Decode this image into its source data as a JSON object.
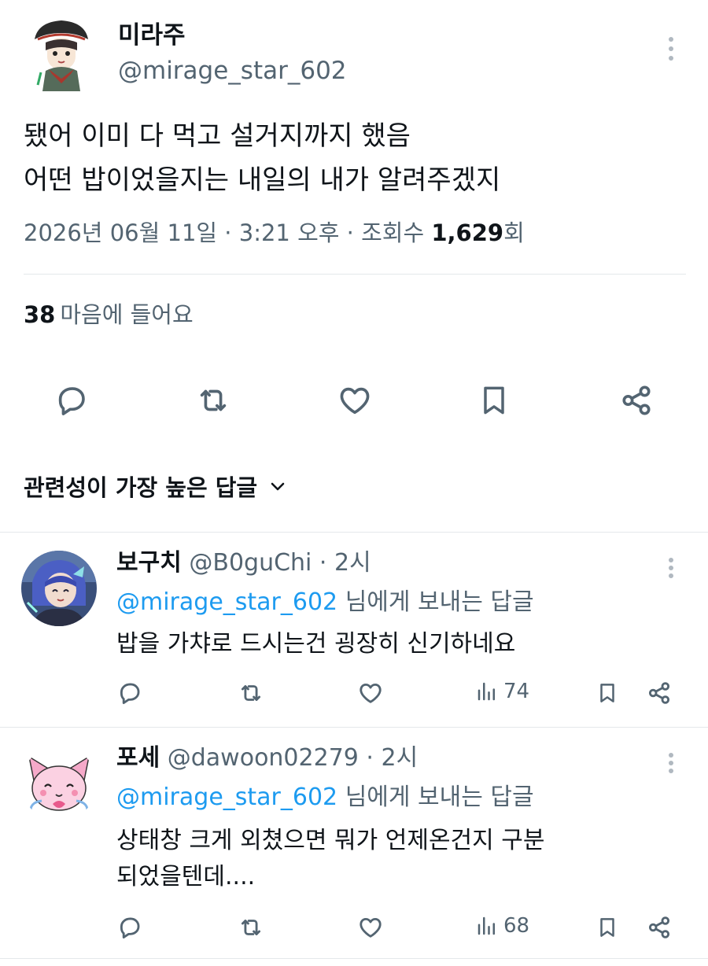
{
  "tweet": {
    "display_name": "미라주",
    "handle": "@mirage_star_602",
    "lines": [
      "됐어 이미 다 먹고 설거지까지 했음",
      "어떤 밥이었을지는 내일의 내가 알려주겠지"
    ],
    "date_time": "2026년 06월 11일 · 3:21 오후 · 조회수 ",
    "views": "1,629",
    "views_suffix": "회",
    "likes_count": "38",
    "likes_label": "마음에 들어요"
  },
  "sort_label": "관련성이 가장 높은 답글",
  "replies": [
    {
      "name": "보구치",
      "handle": "@B0guChi · 2시",
      "mention": "@mirage_star_602",
      "replying_suffix": " 님에게 보내는 답글",
      "lines": [
        "밥을 가챠로 드시는건 굉장히 신기하네요"
      ],
      "views": "74"
    },
    {
      "name": "포세",
      "handle": "@dawoon02279 · 2시",
      "mention": "@mirage_star_602",
      "replying_suffix": " 님에게 보내는 답글",
      "lines": [
        "상태창 크게 외쳤으면 뭐가 언제온건지 구분",
        "되었을텐데...."
      ],
      "views": "68"
    }
  ],
  "icons": [
    "reply-icon",
    "retweet-icon",
    "like-icon",
    "bookmark-icon",
    "share-icon",
    "views-icon",
    "more-icon",
    "chevron-down-icon"
  ],
  "colors": {
    "accent": "#1d9bf0",
    "text": "#0f1419",
    "muted": "#536471"
  }
}
